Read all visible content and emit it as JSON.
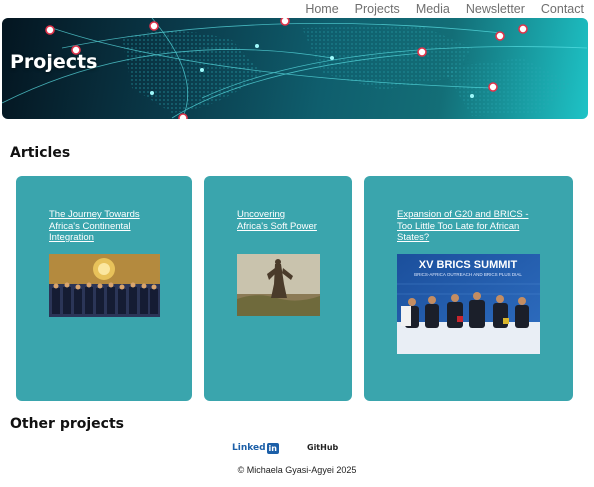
{
  "nav": {
    "items": [
      "Home",
      "Projects",
      "Media",
      "Newsletter",
      "Contact"
    ]
  },
  "hero": {
    "title": "Projects"
  },
  "sections": {
    "articles_title": "Articles",
    "other_title": "Other projects"
  },
  "articles": [
    {
      "title": "The Journey Towards Africa's Continental Integration",
      "image": "summit-group-photo"
    },
    {
      "title": "Uncovering Africa's Soft Power",
      "image": "monument-photo"
    },
    {
      "title": "Expansion of G20 and BRICS - Too Little Too Late for African States?",
      "image": "brics-summit-photo"
    }
  ],
  "brics_banner": {
    "line1": "XV BRICS SUMMIT",
    "line2": "BRICS-AFRICA OUTREACH AND BRICS PLUS DIAL"
  },
  "footer": {
    "linkedin_label": "Linked",
    "linkedin_badge": "in",
    "github_label": "GitHub",
    "copyright": "© Michaela Gyasi-Agyei 2025"
  },
  "colors": {
    "card_bg": "#3aa5ad",
    "nav_text": "#6f6f6f",
    "linkedin": "#1c5fa8"
  }
}
